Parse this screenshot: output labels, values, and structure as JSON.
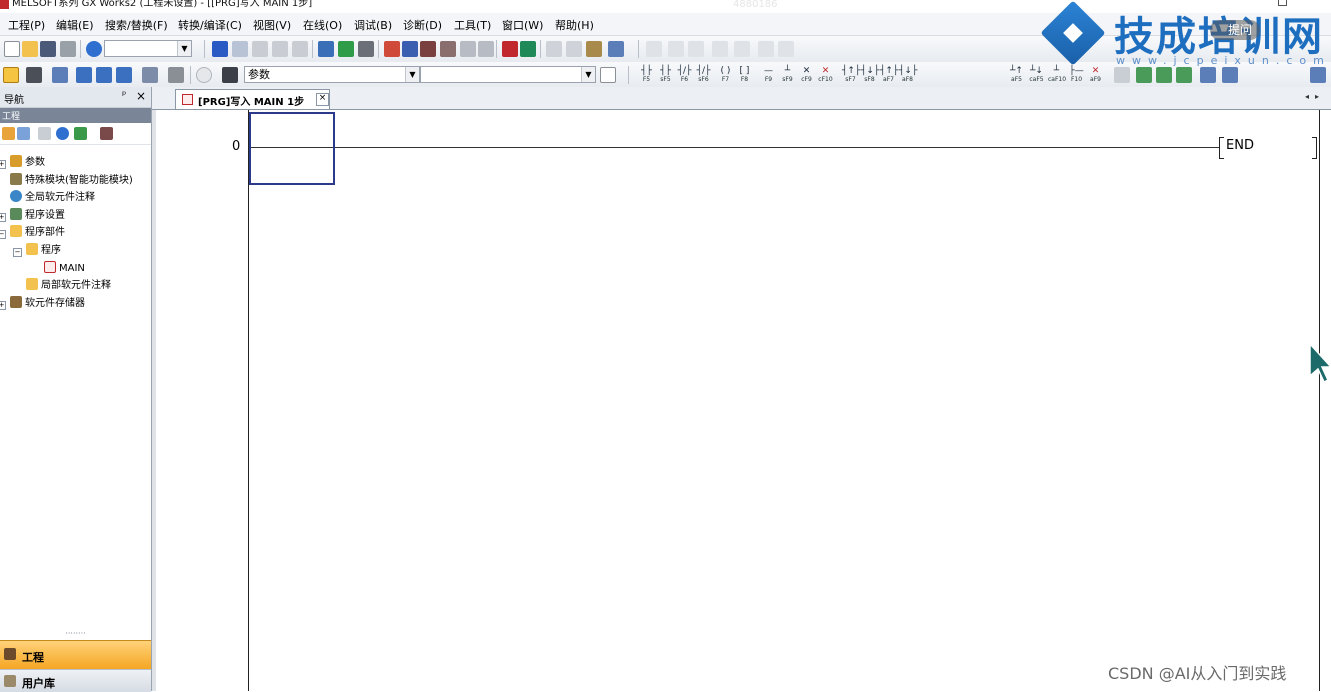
{
  "window": {
    "title": "MELSOFT系列 GX Works2 (工程未设置) - [[PRG]写入 MAIN 1步]",
    "faint_counter": "4880186"
  },
  "menu": [
    "工程(P)",
    "编辑(E)",
    "搜索/替换(F)",
    "转换/编译(C)",
    "视图(V)",
    "在线(O)",
    "调试(B)",
    "诊断(D)",
    "工具(T)",
    "窗口(W)",
    "帮助(H)"
  ],
  "toolbar2": {
    "search_combo_value": "参数"
  },
  "function_keys": [
    "F5",
    "sF5",
    "F6",
    "sF6",
    "F7",
    "F8",
    "F9",
    "sF9",
    "cF9",
    "cF10",
    "sF7",
    "sF8",
    "aF7",
    "aF8",
    "aF5",
    "caF5",
    "caF10",
    "F10",
    "aF9"
  ],
  "nav": {
    "title": "导航",
    "section": "工程",
    "tree": [
      {
        "label": "参数",
        "icon": "parameter-icon"
      },
      {
        "label": "特殊模块(智能功能模块)",
        "icon": "module-icon"
      },
      {
        "label": "全局软元件注释",
        "icon": "comment-icon"
      },
      {
        "label": "程序设置",
        "icon": "program-setting-icon"
      },
      {
        "label": "程序部件",
        "icon": "folder-icon"
      },
      {
        "label": "程序",
        "icon": "folder-icon"
      },
      {
        "label": "MAIN",
        "icon": "program-file-icon"
      },
      {
        "label": "局部软元件注释",
        "icon": "folder-icon"
      },
      {
        "label": "软元件存储器",
        "icon": "memory-icon"
      }
    ],
    "tabs": [
      "工程",
      "用户库"
    ]
  },
  "editor": {
    "tab_label": "[PRG]写入 MAIN 1步",
    "step_number": "0",
    "end_instruction": "END"
  },
  "overlay": {
    "brand": "技成培训网",
    "url": "www.jcpeixun.com",
    "ask_badge": "提问",
    "watermark": "CSDN @AI从入门到实践"
  },
  "colors": {
    "nav_active_tab": "#f5a623",
    "cursor_box": "#2b3a8a",
    "brand_blue": "#1e6ec0",
    "app_icon_red": "#c0282d"
  }
}
